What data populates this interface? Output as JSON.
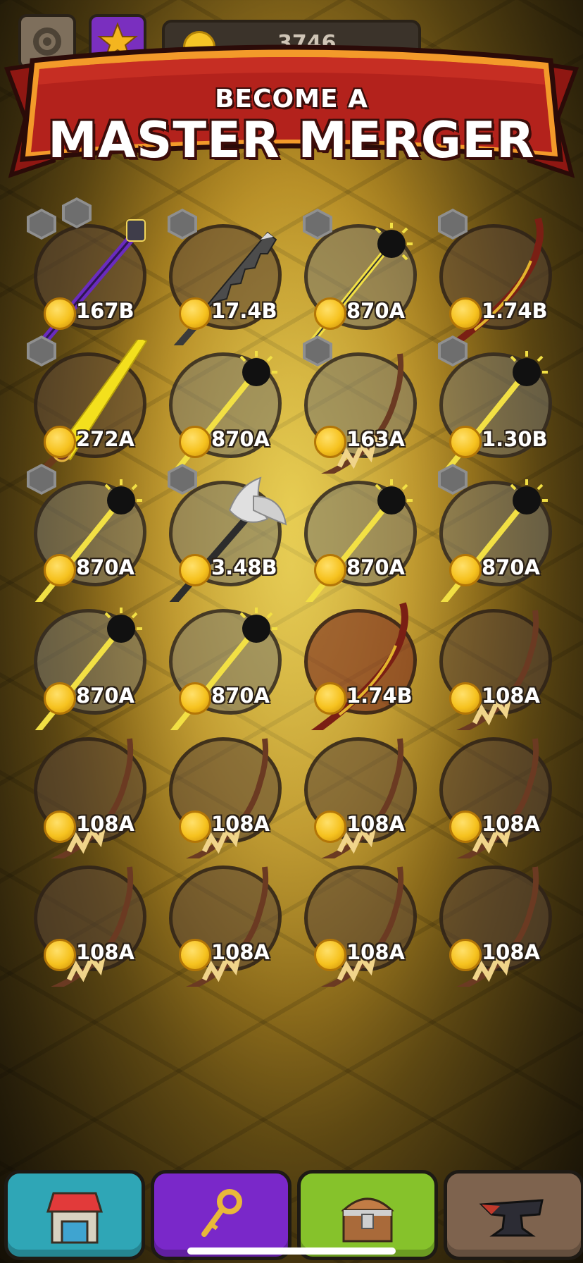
{
  "top_bar": {
    "settings_icon": "gear-icon",
    "star_icon": "star-icon",
    "coin_total_partial": "3746"
  },
  "banner": {
    "line1": "BECOME A",
    "line2": "MASTER MERGER"
  },
  "slots": [
    {
      "value": "167B",
      "weapon": "staff",
      "pad": "brown"
    },
    {
      "value": "17.4B",
      "weapon": "serrated-sword",
      "pad": "brown"
    },
    {
      "value": "870A",
      "weapon": "mace",
      "pad": "grey"
    },
    {
      "value": "1.74B",
      "weapon": "bow-red",
      "pad": "brown"
    },
    {
      "value": "272A",
      "weapon": "golden-sword",
      "pad": "brown"
    },
    {
      "value": "870A",
      "weapon": "mace",
      "pad": "grey"
    },
    {
      "value": "163A",
      "weapon": "bow-bone",
      "pad": "grey"
    },
    {
      "value": "1.30B",
      "weapon": "mace",
      "pad": "grey"
    },
    {
      "value": "870A",
      "weapon": "mace",
      "pad": "grey"
    },
    {
      "value": "3.48B",
      "weapon": "axe",
      "pad": "grey"
    },
    {
      "value": "870A",
      "weapon": "mace",
      "pad": "grey"
    },
    {
      "value": "870A",
      "weapon": "mace",
      "pad": "grey"
    },
    {
      "value": "870A",
      "weapon": "mace",
      "pad": "grey"
    },
    {
      "value": "870A",
      "weapon": "mace",
      "pad": "grey"
    },
    {
      "value": "1.74B",
      "weapon": "bow-red",
      "pad": "red"
    },
    {
      "value": "108A",
      "weapon": "bow-bone",
      "pad": "brown"
    },
    {
      "value": "108A",
      "weapon": "bow-bone",
      "pad": "brown"
    },
    {
      "value": "108A",
      "weapon": "bow-bone",
      "pad": "brown"
    },
    {
      "value": "108A",
      "weapon": "bow-bone",
      "pad": "brown"
    },
    {
      "value": "108A",
      "weapon": "bow-bone",
      "pad": "brown"
    },
    {
      "value": "108A",
      "weapon": "bow-bone",
      "pad": "brown"
    },
    {
      "value": "108A",
      "weapon": "bow-bone",
      "pad": "brown"
    },
    {
      "value": "108A",
      "weapon": "bow-bone",
      "pad": "brown"
    },
    {
      "value": "108A",
      "weapon": "bow-bone",
      "pad": "brown"
    }
  ],
  "toolbar": {
    "shop_icon": "shop-icon",
    "key_icon": "key-icon",
    "chest_icon": "chest-icon",
    "anvil_icon": "anvil-icon"
  },
  "colors": {
    "banner_red": "#b3221c",
    "coin_gold": "#f6c21f",
    "shop_teal": "#2fa6b6",
    "key_purple": "#7a28c9",
    "chest_green": "#86c22b",
    "forge_brown": "#7e634e"
  }
}
